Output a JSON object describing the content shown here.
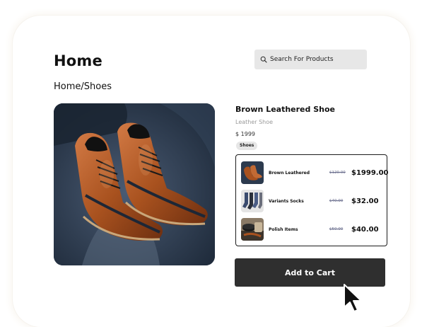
{
  "header": {
    "title": "Home",
    "search_placeholder": "Search For Products"
  },
  "breadcrumb": "Home/Shoes",
  "product": {
    "name": "Brown Leathered Shoe",
    "subtitle": "Leather Shoe",
    "price": "$ 1999",
    "tag": "Shoes"
  },
  "related_items": [
    {
      "name": "Brown Leathered",
      "old_price": "$120.00",
      "price": "$1999.00",
      "thumb_icon": "brown-shoes-thumbnail"
    },
    {
      "name": "Variants Socks",
      "old_price": "$40.00",
      "price": "$32.00",
      "thumb_icon": "socks-thumbnail"
    },
    {
      "name": "Polish Items",
      "old_price": "$50.00",
      "price": "$40.00",
      "thumb_icon": "shoe-polish-thumbnail"
    }
  ],
  "actions": {
    "add_to_cart_label": "Add to Cart"
  },
  "colors": {
    "button_bg": "#2f2f2f",
    "search_bg": "#e7e7e7",
    "strike_price": "#6b6f8e",
    "leather_brown": "#a8532a"
  }
}
